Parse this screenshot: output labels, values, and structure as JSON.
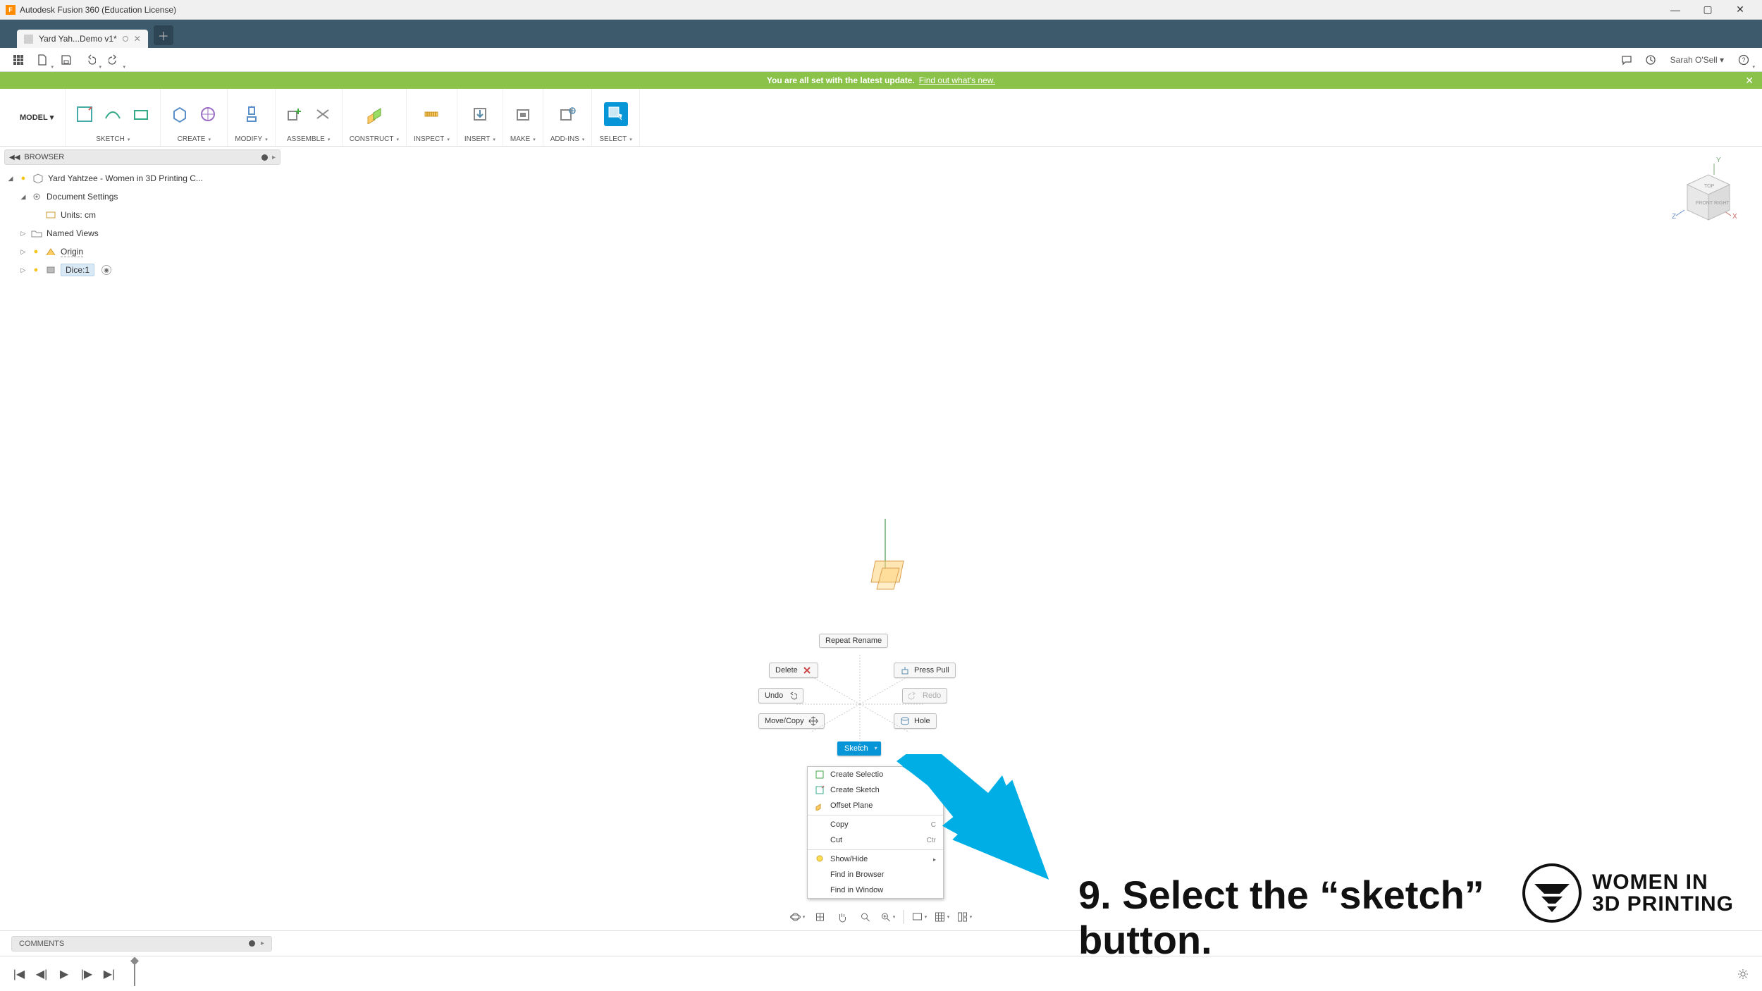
{
  "window": {
    "title": "Autodesk Fusion 360 (Education License)",
    "app_badge": "F"
  },
  "tabs": {
    "doc_name": "Yard Yah...Demo v1*"
  },
  "update_banner": {
    "text_bold": "You are all set with the latest update.",
    "link": "Find out what's new."
  },
  "quick": {
    "user": "Sarah O'Sell"
  },
  "ribbon": {
    "model": "MODEL",
    "groups": [
      "SKETCH",
      "CREATE",
      "MODIFY",
      "ASSEMBLE",
      "CONSTRUCT",
      "INSPECT",
      "INSERT",
      "MAKE",
      "ADD-INS",
      "SELECT"
    ]
  },
  "browser": {
    "title": "BROWSER",
    "root": "Yard Yahtzee - Women in 3D Printing C...",
    "doc_settings": "Document Settings",
    "units": "Units: cm",
    "named_views": "Named Views",
    "origin": "Origin",
    "component": "Dice:1"
  },
  "marking_menu": {
    "repeat": "Repeat Rename",
    "delete": "Delete",
    "press_pull": "Press Pull",
    "undo": "Undo",
    "redo": "Redo",
    "move_copy": "Move/Copy",
    "hole": "Hole",
    "sketch": "Sketch"
  },
  "context_menu": {
    "create_selection": "Create Selectio",
    "create_sketch": "Create Sketch",
    "offset_plane": "Offset Plane",
    "copy": "Copy",
    "copy_sc": "C",
    "cut": "Cut",
    "cut_sc": "Ctr",
    "show_hide": "Show/Hide",
    "find_browser": "Find in Browser",
    "find_window": "Find in Window"
  },
  "instruction": {
    "text_l1": "9. Select the “sketch”",
    "text_l2": "button."
  },
  "logo": {
    "line1": "WOMEN IN",
    "line2": "3D PRINTING"
  },
  "comments": {
    "title": "COMMENTS"
  }
}
